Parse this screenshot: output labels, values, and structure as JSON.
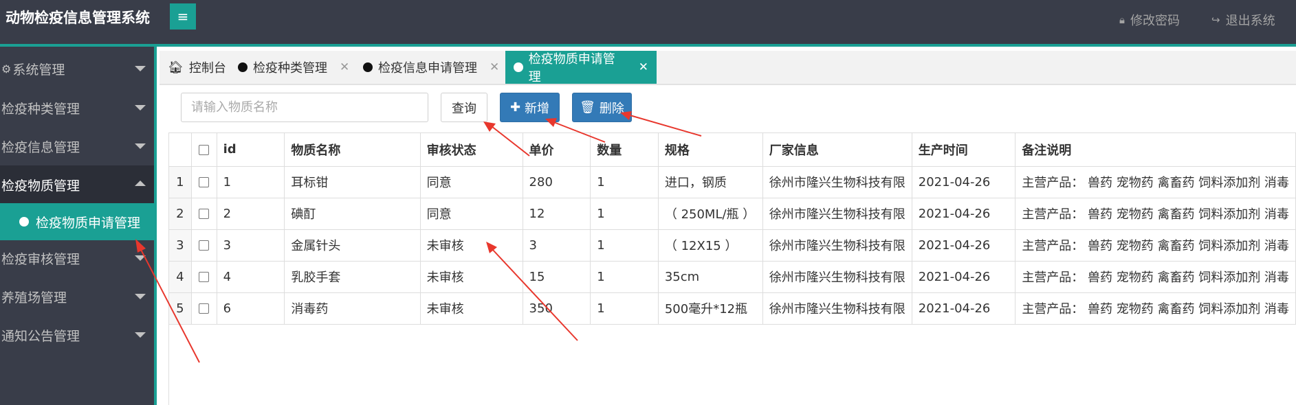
{
  "header": {
    "app_title": "动物检疫信息管理系统",
    "change_password": "修改密码",
    "logout": "退出系统"
  },
  "sidebar": {
    "items": [
      {
        "label": "系统管理"
      },
      {
        "label": "检疫种类管理"
      },
      {
        "label": "检疫信息管理"
      },
      {
        "label": "检疫物质管理"
      },
      {
        "label": "检疫审核管理"
      },
      {
        "label": "养殖场管理"
      },
      {
        "label": "通知公告管理"
      }
    ],
    "active_sub": "检疫物质申请管理"
  },
  "tabs": [
    {
      "label": "控制台"
    },
    {
      "label": "检疫种类管理"
    },
    {
      "label": "检疫信息申请管理"
    },
    {
      "label": "检疫物质申请管理"
    }
  ],
  "toolbar": {
    "search_placeholder": "请输入物质名称",
    "query_label": "查询",
    "add_label": "新增",
    "delete_label": "删除"
  },
  "table": {
    "columns": [
      "id",
      "物质名称",
      "审核状态",
      "单价",
      "数量",
      "规格",
      "厂家信息",
      "生产时间",
      "备注说明"
    ],
    "rows": [
      {
        "rn": "1",
        "id": "1",
        "name": "耳标钳",
        "status": "同意",
        "price": "280",
        "qty": "1",
        "spec": "进口，钢质",
        "vendor": "徐州市隆兴生物科技有限",
        "date": "2021-04-26",
        "note": "主营产品： 兽药 宠物药 禽畜药 饲料添加剂 消毒"
      },
      {
        "rn": "2",
        "id": "2",
        "name": "碘酊",
        "status": "同意",
        "price": "12",
        "qty": "1",
        "spec": "（ 250ML/瓶 ）",
        "vendor": "徐州市隆兴生物科技有限",
        "date": "2021-04-26",
        "note": "主营产品： 兽药 宠物药 禽畜药 饲料添加剂 消毒"
      },
      {
        "rn": "3",
        "id": "3",
        "name": "金属针头",
        "status": "未审核",
        "price": "3",
        "qty": "1",
        "spec": "（ 12X15 ）",
        "vendor": "徐州市隆兴生物科技有限",
        "date": "2021-04-26",
        "note": "主营产品： 兽药 宠物药 禽畜药 饲料添加剂 消毒"
      },
      {
        "rn": "4",
        "id": "4",
        "name": "乳胶手套",
        "status": "未审核",
        "price": "15",
        "qty": "1",
        "spec": "35cm",
        "vendor": "徐州市隆兴生物科技有限",
        "date": "2021-04-26",
        "note": "主营产品： 兽药 宠物药 禽畜药 饲料添加剂 消毒"
      },
      {
        "rn": "5",
        "id": "6",
        "name": "消毒药",
        "status": "未审核",
        "price": "350",
        "qty": "1",
        "spec": "500毫升*12瓶",
        "vendor": "徐州市隆兴生物科技有限",
        "date": "2021-04-26",
        "note": "主营产品： 兽药 宠物药 禽畜药 饲料添加剂 消毒"
      }
    ]
  },
  "colors": {
    "header_bg": "#393d49",
    "accent": "#1aa094",
    "primary_button": "#337ab7",
    "annotation_arrow": "#e8372d"
  }
}
